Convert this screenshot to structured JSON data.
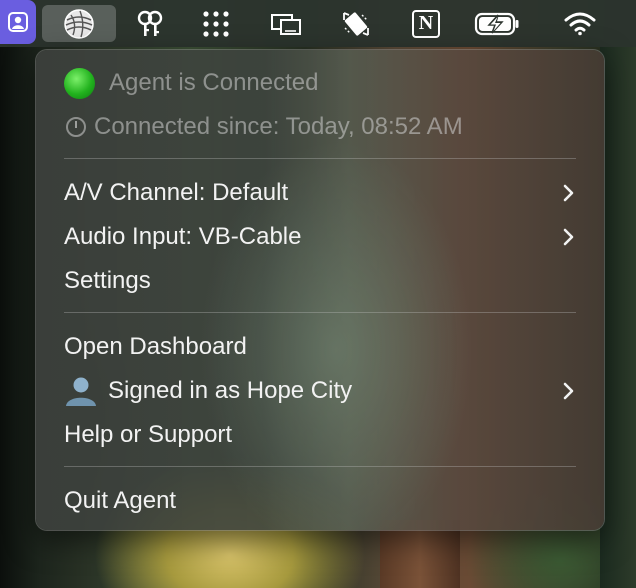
{
  "colors": {
    "user_badge": "#6a5ee0",
    "status_connected": "#22b21e"
  },
  "menubar": {
    "icons": [
      "contacts-icon",
      "agent-globe-icon",
      "keys-icon",
      "dots-grid-icon",
      "display-mirror-icon",
      "rotate-icon",
      "notion-icon",
      "battery-charging-icon",
      "wifi-icon"
    ],
    "notion_letter": "N"
  },
  "menu": {
    "status": "Agent is Connected",
    "connected_since": "Connected since: Today, 08:52 AM",
    "av_channel": "A/V Channel: Default",
    "audio_input": "Audio Input: VB-Cable",
    "settings": "Settings",
    "open_dashboard": "Open Dashboard",
    "signed_in": "Signed in as Hope City",
    "help": "Help or Support",
    "quit": "Quit Agent"
  }
}
